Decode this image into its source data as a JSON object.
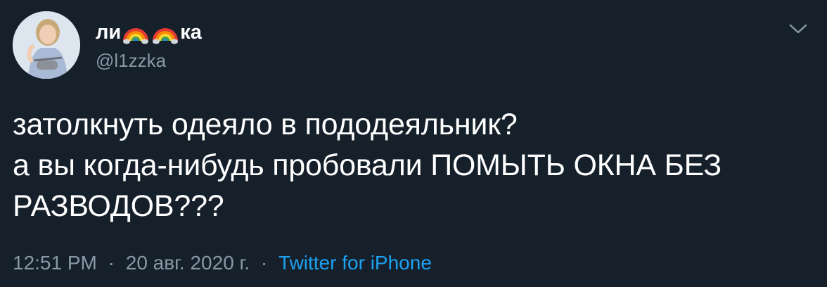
{
  "author": {
    "name_part1": "ли",
    "name_part2": "ка",
    "name_emoji": "rainbow-emoji",
    "handle": "@l1zzka"
  },
  "tweet": {
    "lines": [
      "затолкнуть одеяло в пододеяльник?",
      "а вы когда-нибудь пробовали ПОМЫТЬ ОКНА БЕЗ",
      "РАЗВОДОВ???"
    ]
  },
  "meta": {
    "time": "12:51 PM",
    "separator": "·",
    "date": "20 авг. 2020 г.",
    "source": "Twitter for iPhone"
  },
  "colors": {
    "background": "#15202b",
    "text": "#ffffff",
    "secondary": "#8899a6",
    "link": "#1da1f2"
  },
  "icons": {
    "menu": "chevron-down-icon"
  }
}
